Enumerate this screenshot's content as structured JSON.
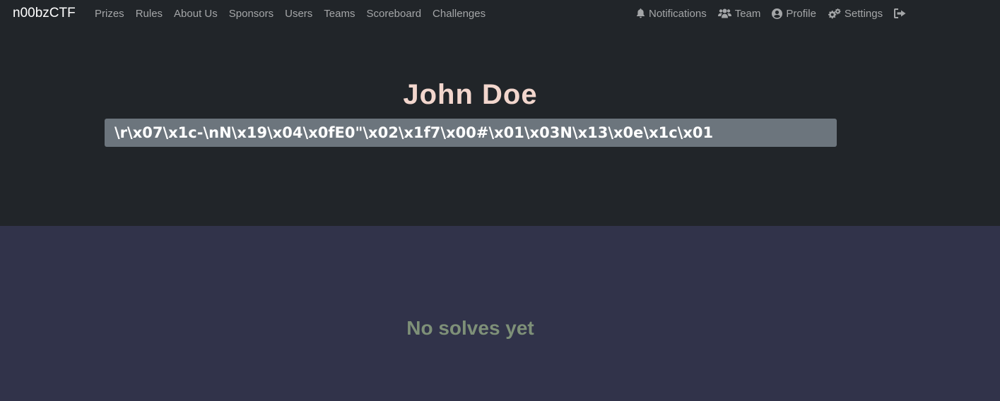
{
  "navbar": {
    "brand": "n00bzCTF",
    "left_links": [
      {
        "label": "Prizes"
      },
      {
        "label": "Rules"
      },
      {
        "label": "About Us"
      },
      {
        "label": "Sponsors"
      },
      {
        "label": "Users"
      },
      {
        "label": "Teams"
      },
      {
        "label": "Scoreboard"
      },
      {
        "label": "Challenges"
      }
    ],
    "right_links": [
      {
        "label": "Notifications",
        "icon": "bell-icon"
      },
      {
        "label": "Team",
        "icon": "users-icon"
      },
      {
        "label": "Profile",
        "icon": "user-circle-icon"
      },
      {
        "label": "Settings",
        "icon": "cogs-icon"
      }
    ],
    "logout_icon": "sign-out-icon"
  },
  "profile": {
    "name": "John Doe",
    "affiliation": "\\r\\x07\\x1c-\\nN\\x19\\x04\\x0fE0\"\\x02\\x1f7\\x00#\\x01\\x03N\\x13\\x0e\\x1c\\x01"
  },
  "solves": {
    "empty_message": "No solves yet"
  },
  "colors": {
    "navbar_bg": "#212529",
    "page_bg": "#31334a",
    "name_color": "#f2d6cd",
    "badge_bg": "#6c757d",
    "empty_text": "#7e9078"
  }
}
